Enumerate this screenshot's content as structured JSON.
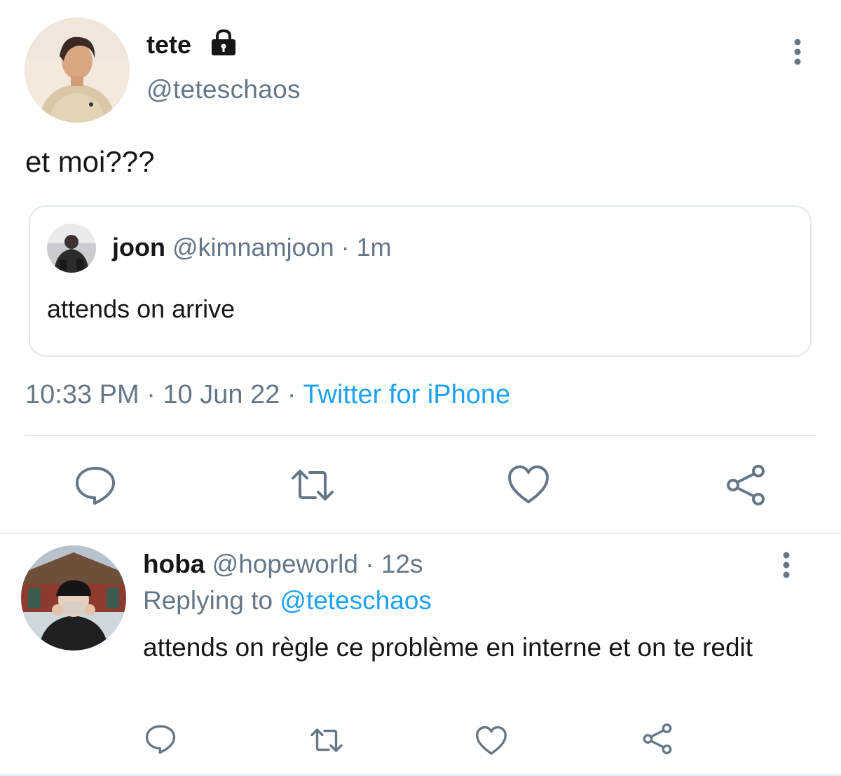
{
  "main_tweet": {
    "display_name": "tete",
    "handle": "@teteschaos",
    "protected_icon": "lock-icon",
    "text": "et moi???",
    "timestamp": "10:33 PM · 10 Jun 22 · ",
    "source": "Twitter for iPhone",
    "more_icon": "more-vertical-icon"
  },
  "quoted_tweet": {
    "display_name": "joon",
    "handle": "@kimnamjoon",
    "separator": " · ",
    "time": "1m",
    "text": "attends on arrive"
  },
  "actions": {
    "reply_icon": "reply-icon",
    "retweet_icon": "retweet-icon",
    "like_icon": "heart-icon",
    "share_icon": "share-icon"
  },
  "reply_tweet": {
    "display_name": "hoba",
    "handle": "@hopeworld",
    "separator": " · ",
    "time": "12s",
    "replying_prefix": "Replying to ",
    "replying_to": "@teteschaos",
    "text": "attends on règle ce problème en interne et on te redit",
    "more_icon": "more-vertical-icon"
  },
  "colors": {
    "text": "#14171a",
    "secondary": "#657786",
    "link": "#1da1f2",
    "border": "#e1e8ed",
    "icon": "#657786"
  }
}
